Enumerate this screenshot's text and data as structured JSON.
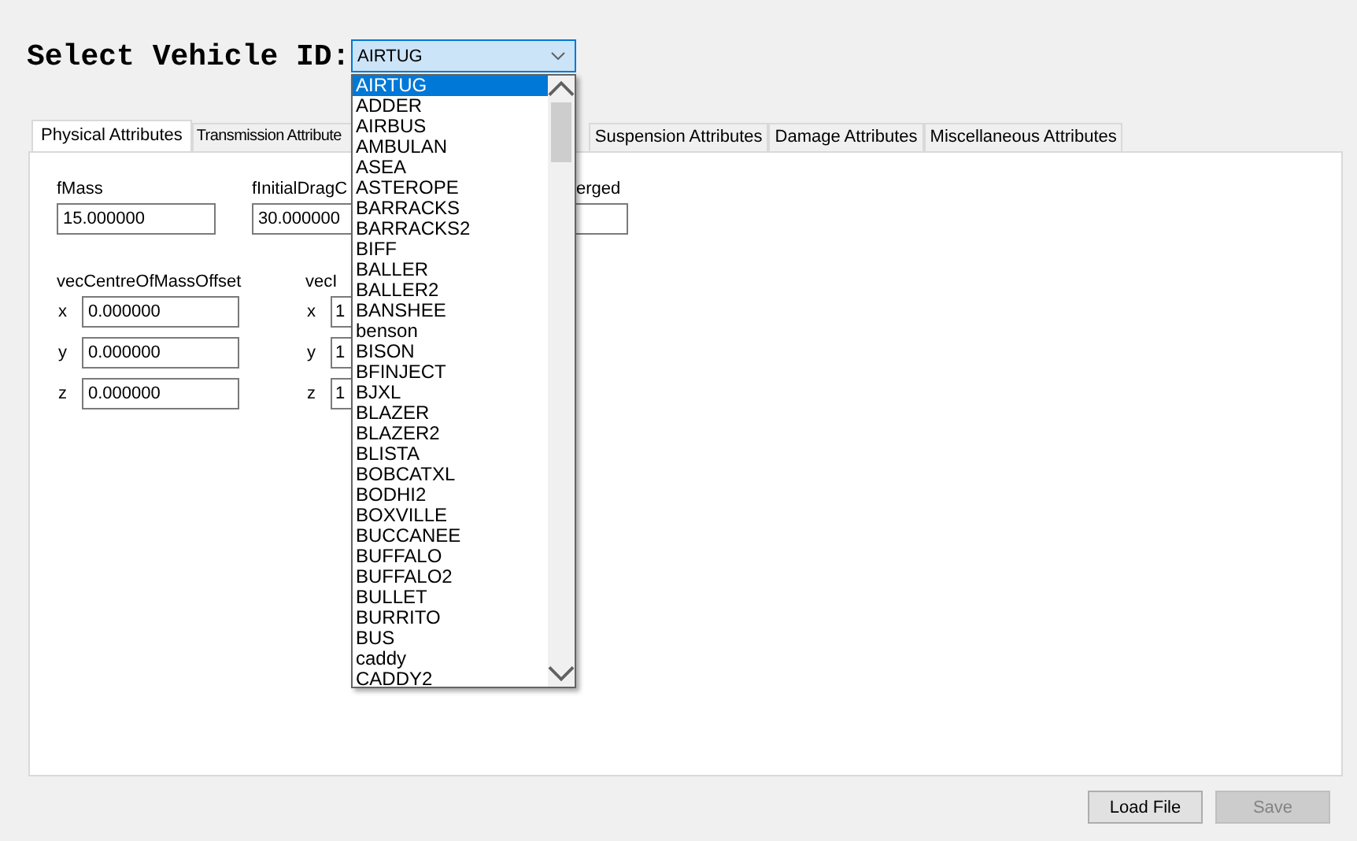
{
  "title": "Select Vehicle ID:",
  "vehicle_select": {
    "value": "AIRTUG",
    "expanded": true,
    "options": [
      {
        "label": "AIRTUG",
        "selected": true
      },
      {
        "label": "ADDER",
        "selected": false
      },
      {
        "label": "AIRBUS",
        "selected": false
      },
      {
        "label": "AMBULAN",
        "selected": false
      },
      {
        "label": "ASEA",
        "selected": false
      },
      {
        "label": "ASTEROPE",
        "selected": false
      },
      {
        "label": "BARRACKS",
        "selected": false
      },
      {
        "label": "BARRACKS2",
        "selected": false
      },
      {
        "label": "BIFF",
        "selected": false
      },
      {
        "label": "BALLER",
        "selected": false
      },
      {
        "label": "BALLER2",
        "selected": false
      },
      {
        "label": "BANSHEE",
        "selected": false
      },
      {
        "label": "benson",
        "selected": false
      },
      {
        "label": "BISON",
        "selected": false
      },
      {
        "label": "BFINJECT",
        "selected": false
      },
      {
        "label": "BJXL",
        "selected": false
      },
      {
        "label": "BLAZER",
        "selected": false
      },
      {
        "label": "BLAZER2",
        "selected": false
      },
      {
        "label": "BLISTA",
        "selected": false
      },
      {
        "label": "BOBCATXL",
        "selected": false
      },
      {
        "label": "BODHI2",
        "selected": false
      },
      {
        "label": "BOXVILLE",
        "selected": false
      },
      {
        "label": "BUCCANEE",
        "selected": false
      },
      {
        "label": "BUFFALO",
        "selected": false
      },
      {
        "label": "BUFFALO2",
        "selected": false
      },
      {
        "label": "BULLET",
        "selected": false
      },
      {
        "label": "BURRITO",
        "selected": false
      },
      {
        "label": "BUS",
        "selected": false
      },
      {
        "label": "caddy",
        "selected": false
      },
      {
        "label": "CADDY2",
        "selected": false
      }
    ]
  },
  "tabs": [
    {
      "label": "Physical Attributes",
      "selected": true
    },
    {
      "label": "Transmission Attribute",
      "selected": false
    },
    {
      "label": "Suspension Attributes",
      "selected": false
    },
    {
      "label": "Damage Attributes",
      "selected": false
    },
    {
      "label": "Miscellaneous Attributes",
      "selected": false
    }
  ],
  "fields": [
    {
      "label": "fMass",
      "value": "15.000000"
    },
    {
      "label": "fInitialDragC",
      "value": "30.000000"
    },
    {
      "label": "erged"
    }
  ],
  "vectors": [
    {
      "label": "vecCentreOfMassOffset",
      "components": [
        {
          "axis": "x",
          "value": "0.000000"
        },
        {
          "axis": "y",
          "value": "0.000000"
        },
        {
          "axis": "z",
          "value": "0.000000"
        }
      ]
    },
    {
      "label": "vecI",
      "components": [
        {
          "axis": "x",
          "value": "1"
        },
        {
          "axis": "y",
          "value": "1"
        },
        {
          "axis": "z",
          "value": "1"
        }
      ]
    }
  ],
  "buttons": [
    {
      "label": "Load File",
      "disabled": false
    },
    {
      "label": "Save",
      "disabled": true
    }
  ]
}
